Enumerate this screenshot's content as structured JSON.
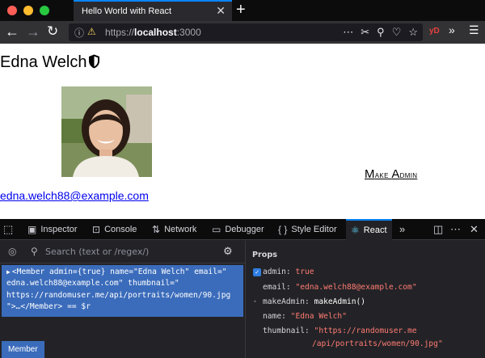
{
  "browser": {
    "tab_title": "Hello World with React",
    "tab_close_icon": "close-icon",
    "new_tab_icon": "plus-icon",
    "url_scheme": "https://",
    "url_host": "localhost",
    "url_port": ":3000",
    "extension_badge": "yD",
    "colors": {
      "titlebar": "#0c0c0d",
      "tab": "#2a2a2e",
      "accent": "#0a84ff",
      "navbar": "#323234"
    }
  },
  "page": {
    "name": "Edna Welch",
    "make_admin_first": "M",
    "make_admin_mid": "ake ",
    "make_admin_second": "A",
    "make_admin_rest": "dmin",
    "email": "edna.welch88@example.com"
  },
  "devtools": {
    "tabs": {
      "inspector": "Inspector",
      "console": "Console",
      "network": "Network",
      "debugger": "Debugger",
      "style_editor": "Style Editor",
      "react": "React"
    },
    "search_placeholder": "Search (text or /regex/)",
    "tree": {
      "line1": "<Member admin={true} name=\"Edna Welch\" email=\"",
      "line2": "edna.welch88@example.com\" thumbnail=\"",
      "line3": "https://randomuser.me/api/portraits/women/90.jpg",
      "line4": "\">…</Member> == $r"
    },
    "breadcrumb": "Member",
    "props_title": "Props",
    "props": {
      "admin_key": "admin:",
      "admin_val": "true",
      "email_key": "email:",
      "email_val": "\"edna.welch88@example.com\"",
      "makeadmin_key": "makeAdmin:",
      "makeadmin_val": "makeAdmin()",
      "name_key": "name:",
      "name_val": "\"Edna Welch\"",
      "thumbnail_key": "thumbnail:",
      "thumbnail_val1": "\"https://randomuser.me",
      "thumbnail_val2": "/api/portraits/women/90.jpg\""
    }
  }
}
